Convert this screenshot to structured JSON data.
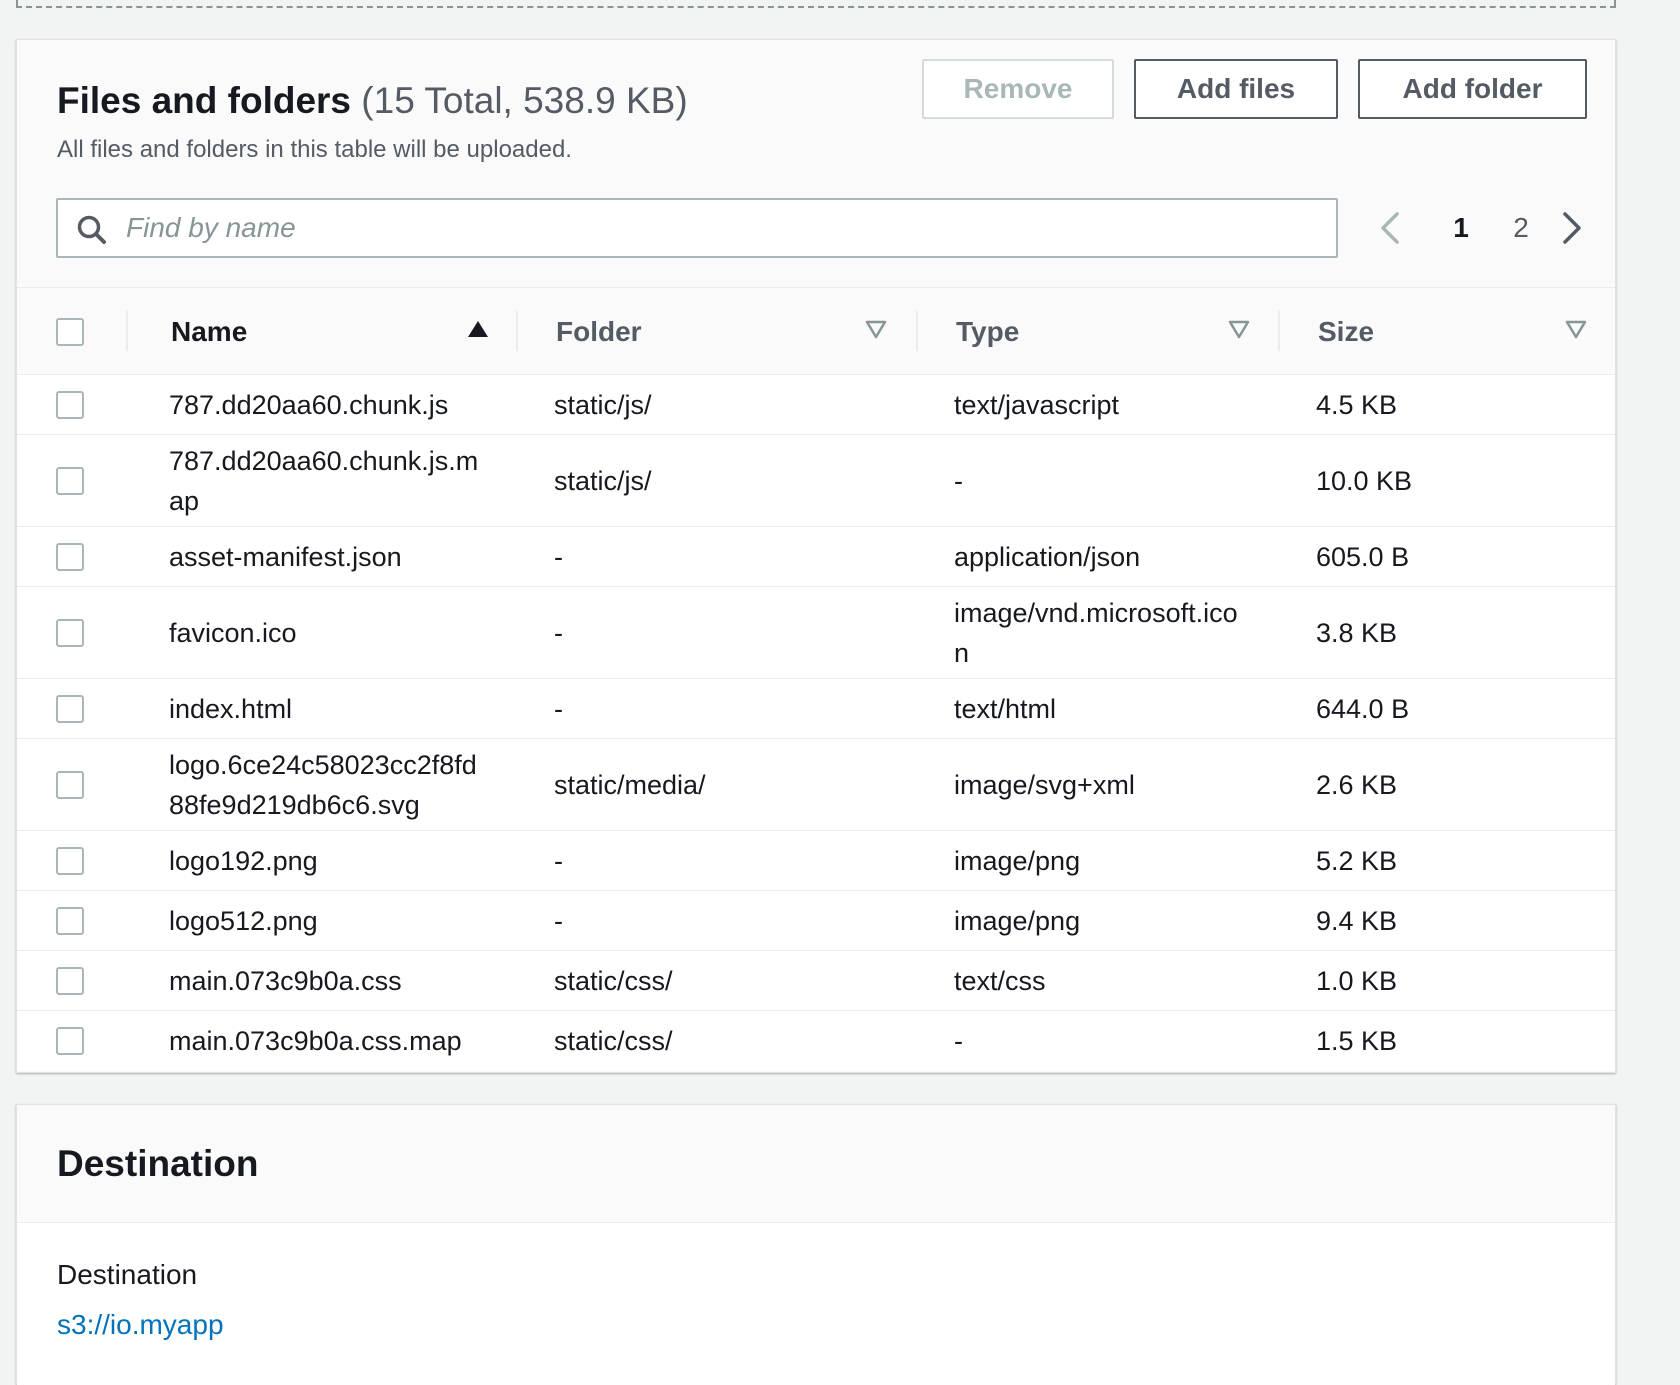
{
  "files_panel": {
    "title": "Files and folders",
    "count": "(15 Total, 538.9 KB)",
    "subtitle": "All files and folders in this table will be uploaded.",
    "buttons": {
      "remove": "Remove",
      "add_files": "Add files",
      "add_folder": "Add folder"
    },
    "search": {
      "placeholder": "Find by name",
      "value": ""
    },
    "pagination": {
      "pages": [
        "1",
        "2"
      ],
      "current": "1"
    },
    "columns": [
      "Name",
      "Folder",
      "Type",
      "Size"
    ],
    "rows": [
      {
        "name": "787.dd20aa60.chunk.js",
        "folder": "static/js/",
        "type": "text/javascript",
        "size": "4.5 KB"
      },
      {
        "name": "787.dd20aa60.chunk.js.map",
        "folder": "static/js/",
        "type": "-",
        "size": "10.0 KB"
      },
      {
        "name": "asset-manifest.json",
        "folder": "-",
        "type": "application/json",
        "size": "605.0 B"
      },
      {
        "name": "favicon.ico",
        "folder": "-",
        "type": "image/vnd.microsoft.icon",
        "size": "3.8 KB"
      },
      {
        "name": "index.html",
        "folder": "-",
        "type": "text/html",
        "size": "644.0 B"
      },
      {
        "name": "logo.6ce24c58023cc2f8fd88fe9d219db6c6.svg",
        "folder": "static/media/",
        "type": "image/svg+xml",
        "size": "2.6 KB"
      },
      {
        "name": "logo192.png",
        "folder": "-",
        "type": "image/png",
        "size": "5.2 KB"
      },
      {
        "name": "logo512.png",
        "folder": "-",
        "type": "image/png",
        "size": "9.4 KB"
      },
      {
        "name": "main.073c9b0a.css",
        "folder": "static/css/",
        "type": "text/css",
        "size": "1.0 KB"
      },
      {
        "name": "main.073c9b0a.css.map",
        "folder": "static/css/",
        "type": "-",
        "size": "1.5 KB"
      }
    ]
  },
  "destination_panel": {
    "title": "Destination",
    "label": "Destination",
    "link": "s3://io.myapp"
  },
  "icons": {
    "search": "search-icon",
    "prev": "chevron-left-icon",
    "next": "chevron-right-icon",
    "sort_asc": "sort-ascending-icon",
    "sort": "sort-icon"
  },
  "colors": {
    "link": "#0073bb",
    "text": "#16191f",
    "secondary_text": "#545b64"
  }
}
